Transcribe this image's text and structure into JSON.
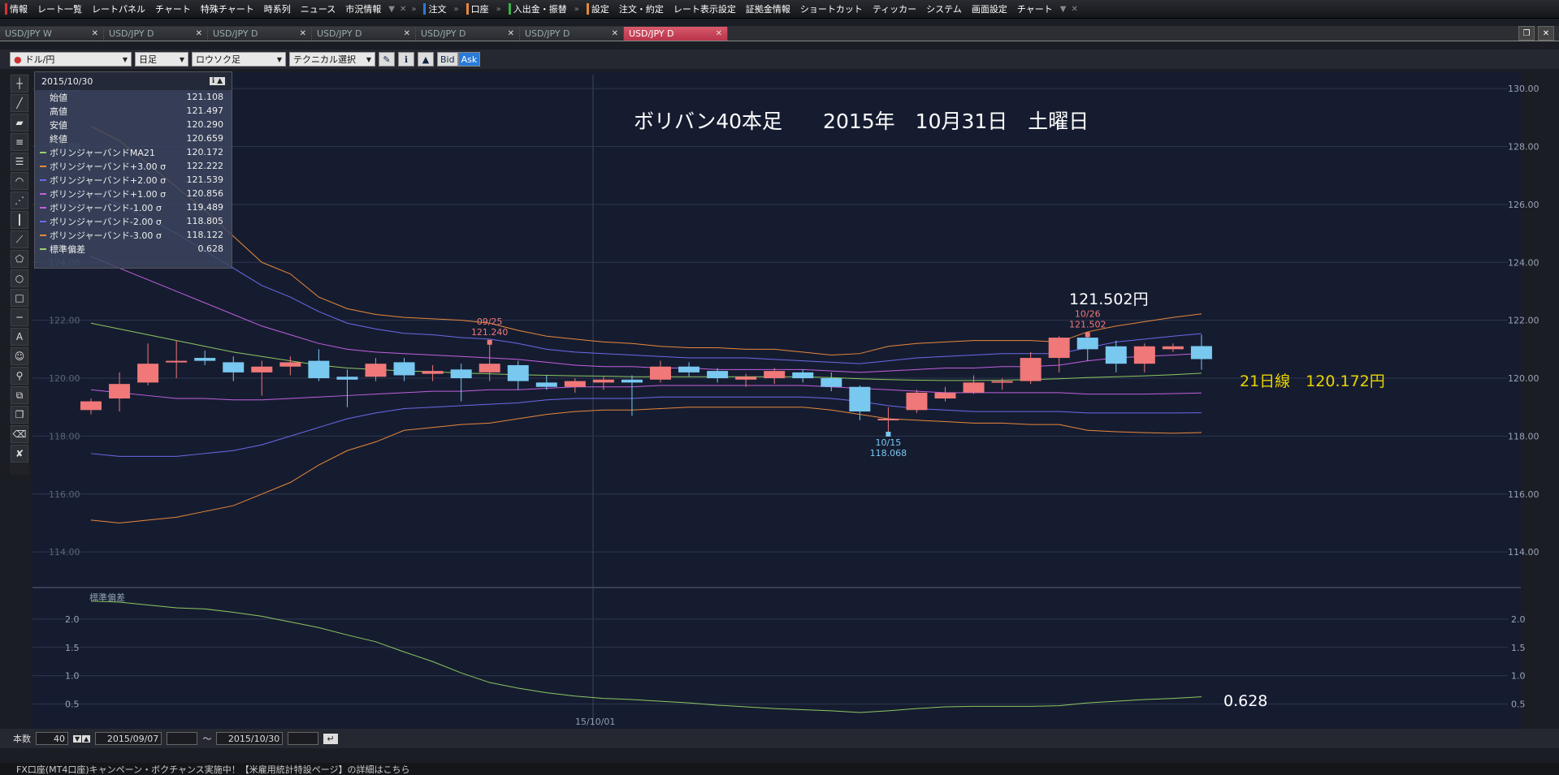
{
  "menubar": {
    "items": [
      "情報",
      "レート一覧",
      "レートパネル",
      "チャート",
      "特殊チャート",
      "時系列",
      "ニュース",
      "市況情報"
    ],
    "order_label": "注文",
    "account_label": "口座",
    "deposit_label": "入出金・振替",
    "settings_items": [
      "設定",
      "注文・約定",
      "レート表示設定",
      "証拠金情報",
      "ショートカット",
      "ティッカー",
      "システム",
      "画面設定",
      "チャート"
    ]
  },
  "tabs": [
    {
      "label": "USD/JPY W",
      "active": false
    },
    {
      "label": "USD/JPY D",
      "active": false
    },
    {
      "label": "USD/JPY D",
      "active": false
    },
    {
      "label": "USD/JPY D",
      "active": false
    },
    {
      "label": "USD/JPY D",
      "active": false
    },
    {
      "label": "USD/JPY D",
      "active": false
    },
    {
      "label": "USD/JPY D",
      "active": true
    }
  ],
  "toolbar": {
    "pair": "ドル/円",
    "period": "日足",
    "style": "ロウソク足",
    "technical": "テクニカル選択",
    "bid": "Bid",
    "ask": "Ask"
  },
  "info": {
    "date": "2015/10/30",
    "rows": [
      {
        "label": "始値",
        "value": "121.108",
        "color": ""
      },
      {
        "label": "高値",
        "value": "121.497",
        "color": ""
      },
      {
        "label": "安値",
        "value": "120.290",
        "color": ""
      },
      {
        "label": "終値",
        "value": "120.659",
        "color": ""
      },
      {
        "label": "ボリンジャーバンドMA21",
        "value": "120.172",
        "color": "#9ad06a"
      },
      {
        "label": "ボリンジャーバンド+3.00 σ",
        "value": "122.222",
        "color": "#e8883a"
      },
      {
        "label": "ボリンジャーバンド+2.00 σ",
        "value": "121.539",
        "color": "#6a6ae8"
      },
      {
        "label": "ボリンジャーバンド+1.00 σ",
        "value": "120.856",
        "color": "#c060e0"
      },
      {
        "label": "ボリンジャーバンド-1.00 σ",
        "value": "119.489",
        "color": "#c060e0"
      },
      {
        "label": "ボリンジャーバンド-2.00 σ",
        "value": "118.805",
        "color": "#6a6ae8"
      },
      {
        "label": "ボリンジャーバンド-3.00 σ",
        "value": "118.122",
        "color": "#e8883a"
      },
      {
        "label": "標準偏差",
        "value": "0.628",
        "color": "#9ad06a"
      }
    ]
  },
  "chart_data": {
    "type": "candlestick",
    "title": "ボリバン40本足　　2015年　10月31日　土曜日",
    "ylim": [
      113.5,
      130.2
    ],
    "yticks": [
      "130.00",
      "128.00",
      "126.00",
      "124.00",
      "122.00",
      "120.00",
      "118.00",
      "116.00",
      "114.00"
    ],
    "candles": [
      {
        "o": 118.9,
        "h": 119.3,
        "l": 118.75,
        "c": 119.2
      },
      {
        "o": 119.3,
        "h": 120.2,
        "l": 118.85,
        "c": 119.8
      },
      {
        "o": 119.85,
        "h": 121.2,
        "l": 119.75,
        "c": 120.5
      },
      {
        "o": 120.55,
        "h": 121.3,
        "l": 120.0,
        "c": 120.6
      },
      {
        "o": 120.7,
        "h": 120.95,
        "l": 120.45,
        "c": 120.6
      },
      {
        "o": 120.55,
        "h": 120.75,
        "l": 119.9,
        "c": 120.2
      },
      {
        "o": 120.2,
        "h": 120.6,
        "l": 119.4,
        "c": 120.4
      },
      {
        "o": 120.4,
        "h": 120.75,
        "l": 120.1,
        "c": 120.55
      },
      {
        "o": 120.6,
        "h": 121.0,
        "l": 119.9,
        "c": 120.0
      },
      {
        "o": 120.05,
        "h": 120.3,
        "l": 119.0,
        "c": 119.95
      },
      {
        "o": 120.05,
        "h": 120.7,
        "l": 119.9,
        "c": 120.5
      },
      {
        "o": 120.55,
        "h": 120.7,
        "l": 119.9,
        "c": 120.1
      },
      {
        "o": 120.15,
        "h": 120.45,
        "l": 119.9,
        "c": 120.25
      },
      {
        "o": 120.3,
        "h": 120.5,
        "l": 119.2,
        "c": 120.0
      },
      {
        "o": 120.2,
        "h": 121.24,
        "l": 119.9,
        "c": 120.5
      },
      {
        "o": 120.45,
        "h": 120.6,
        "l": 119.6,
        "c": 119.9
      },
      {
        "o": 119.85,
        "h": 120.1,
        "l": 119.6,
        "c": 119.7
      },
      {
        "o": 119.7,
        "h": 120.0,
        "l": 119.5,
        "c": 119.9
      },
      {
        "o": 119.85,
        "h": 120.05,
        "l": 119.6,
        "c": 119.95
      },
      {
        "o": 119.95,
        "h": 120.1,
        "l": 118.7,
        "c": 119.85
      },
      {
        "o": 119.95,
        "h": 120.6,
        "l": 119.85,
        "c": 120.4
      },
      {
        "o": 120.4,
        "h": 120.55,
        "l": 120.05,
        "c": 120.2
      },
      {
        "o": 120.25,
        "h": 120.35,
        "l": 119.85,
        "c": 120.0
      },
      {
        "o": 119.95,
        "h": 120.15,
        "l": 119.7,
        "c": 120.05
      },
      {
        "o": 120.0,
        "h": 120.35,
        "l": 119.8,
        "c": 120.25
      },
      {
        "o": 120.2,
        "h": 120.3,
        "l": 119.85,
        "c": 120.0
      },
      {
        "o": 120.0,
        "h": 120.2,
        "l": 119.55,
        "c": 119.7
      },
      {
        "o": 119.7,
        "h": 119.75,
        "l": 118.55,
        "c": 118.85
      },
      {
        "o": 118.6,
        "h": 119.0,
        "l": 118.068,
        "c": 118.6
      },
      {
        "o": 118.9,
        "h": 119.6,
        "l": 118.8,
        "c": 119.5
      },
      {
        "o": 119.3,
        "h": 119.7,
        "l": 119.2,
        "c": 119.5
      },
      {
        "o": 119.5,
        "h": 120.1,
        "l": 119.45,
        "c": 119.85
      },
      {
        "o": 119.85,
        "h": 120.0,
        "l": 119.6,
        "c": 119.9
      },
      {
        "o": 119.9,
        "h": 120.9,
        "l": 119.8,
        "c": 120.7
      },
      {
        "o": 120.7,
        "h": 121.45,
        "l": 120.2,
        "c": 121.4
      },
      {
        "o": 121.4,
        "h": 121.502,
        "l": 120.6,
        "c": 121.0
      },
      {
        "o": 121.1,
        "h": 121.3,
        "l": 120.2,
        "c": 120.5
      },
      {
        "o": 120.5,
        "h": 121.2,
        "l": 120.2,
        "c": 121.1
      },
      {
        "o": 121.0,
        "h": 121.2,
        "l": 120.9,
        "c": 121.1
      },
      {
        "o": 121.108,
        "h": 121.497,
        "l": 120.29,
        "c": 120.659
      }
    ],
    "bands": {
      "ma21": [
        121.9,
        121.7,
        121.5,
        121.3,
        121.1,
        120.9,
        120.75,
        120.6,
        120.45,
        120.35,
        120.3,
        120.25,
        120.22,
        120.18,
        120.15,
        120.12,
        120.1,
        120.08,
        120.07,
        120.05,
        120.05,
        120.05,
        120.05,
        120.05,
        120.05,
        120.05,
        120.02,
        119.98,
        119.95,
        119.93,
        119.92,
        119.92,
        119.93,
        119.95,
        119.98,
        120.02,
        120.05,
        120.08,
        120.12,
        120.172
      ],
      "p3": [
        128.7,
        128.2,
        127.4,
        126.6,
        125.8,
        124.9,
        124.0,
        123.6,
        122.8,
        122.4,
        122.2,
        122.1,
        122.05,
        122.0,
        121.9,
        121.65,
        121.45,
        121.35,
        121.25,
        121.2,
        121.1,
        121.05,
        121.05,
        121.0,
        121.0,
        120.9,
        120.8,
        120.85,
        121.1,
        121.2,
        121.25,
        121.3,
        121.3,
        121.3,
        121.25,
        121.6,
        121.8,
        121.95,
        122.1,
        122.222
      ],
      "p2": [
        126.4,
        126.0,
        125.5,
        125.0,
        124.4,
        123.8,
        123.2,
        122.8,
        122.3,
        121.9,
        121.7,
        121.55,
        121.5,
        121.4,
        121.35,
        121.2,
        121.0,
        120.9,
        120.85,
        120.8,
        120.75,
        120.7,
        120.7,
        120.7,
        120.65,
        120.6,
        120.55,
        120.5,
        120.6,
        120.7,
        120.75,
        120.8,
        120.85,
        120.85,
        120.85,
        121.05,
        121.25,
        121.35,
        121.45,
        121.539
      ],
      "p1": [
        124.2,
        123.8,
        123.4,
        123.0,
        122.6,
        122.2,
        121.8,
        121.5,
        121.2,
        121.0,
        120.9,
        120.85,
        120.8,
        120.75,
        120.7,
        120.65,
        120.55,
        120.45,
        120.4,
        120.4,
        120.35,
        120.35,
        120.3,
        120.3,
        120.3,
        120.3,
        120.25,
        120.2,
        120.25,
        120.3,
        120.35,
        120.35,
        120.4,
        120.4,
        120.45,
        120.6,
        120.7,
        120.75,
        120.8,
        120.856
      ],
      "m1": [
        119.6,
        119.5,
        119.4,
        119.3,
        119.3,
        119.25,
        119.25,
        119.3,
        119.35,
        119.4,
        119.45,
        119.5,
        119.55,
        119.55,
        119.6,
        119.6,
        119.65,
        119.7,
        119.7,
        119.7,
        119.75,
        119.75,
        119.75,
        119.75,
        119.75,
        119.75,
        119.7,
        119.65,
        119.6,
        119.55,
        119.5,
        119.5,
        119.5,
        119.5,
        119.5,
        119.45,
        119.45,
        119.45,
        119.47,
        119.489
      ],
      "m2": [
        117.4,
        117.3,
        117.3,
        117.3,
        117.4,
        117.5,
        117.7,
        118.0,
        118.3,
        118.6,
        118.8,
        118.95,
        119.0,
        119.05,
        119.1,
        119.15,
        119.25,
        119.3,
        119.3,
        119.3,
        119.35,
        119.35,
        119.35,
        119.35,
        119.35,
        119.35,
        119.3,
        119.2,
        119.05,
        118.95,
        118.9,
        118.85,
        118.85,
        118.85,
        118.85,
        118.8,
        118.8,
        118.8,
        118.8,
        118.805
      ],
      "m3": [
        115.1,
        115.0,
        115.1,
        115.2,
        115.4,
        115.6,
        116.0,
        116.4,
        117.0,
        117.5,
        117.8,
        118.2,
        118.3,
        118.4,
        118.45,
        118.6,
        118.75,
        118.85,
        118.9,
        118.9,
        118.95,
        119.0,
        119.0,
        119.0,
        119.0,
        119.0,
        118.9,
        118.75,
        118.6,
        118.55,
        118.5,
        118.45,
        118.45,
        118.4,
        118.4,
        118.2,
        118.15,
        118.12,
        118.1,
        118.122
      ]
    },
    "markers": [
      {
        "date": "09/25",
        "price": "121.240",
        "idx": 14,
        "value": 121.24,
        "type": "high"
      },
      {
        "date": "10/26",
        "price": "121.502",
        "idx": 35,
        "value": 121.502,
        "type": "high"
      },
      {
        "date": "10/15",
        "price": "118.068",
        "idx": 28,
        "value": 118.068,
        "type": "low"
      }
    ],
    "annotations": {
      "high": "121.502円",
      "ma": "21日線　120.172円",
      "sd": "0.628"
    },
    "stddev": {
      "label": "標準偏差",
      "ylim": [
        0.25,
        2.4
      ],
      "yticks": [
        "2.0",
        "1.5",
        "1.0",
        "0.5"
      ],
      "values": [
        2.32,
        2.3,
        2.25,
        2.2,
        2.18,
        2.12,
        2.05,
        1.95,
        1.85,
        1.72,
        1.6,
        1.42,
        1.25,
        1.05,
        0.88,
        0.78,
        0.7,
        0.64,
        0.6,
        0.58,
        0.55,
        0.52,
        0.48,
        0.45,
        0.42,
        0.4,
        0.38,
        0.35,
        0.38,
        0.42,
        0.45,
        0.46,
        0.46,
        0.46,
        0.47,
        0.52,
        0.55,
        0.58,
        0.6,
        0.628
      ]
    },
    "xlabel_mid": "15/10/01"
  },
  "bottom": {
    "bars_label": "本数",
    "bars": "40",
    "from": "2015/09/07",
    "tilde": "〜",
    "to": "2015/10/30"
  },
  "ticker": "FX口座(MT4口座)キャンペーン・ボクチャンス実施中！【米雇用統計特設ページ】の詳細はこちら"
}
